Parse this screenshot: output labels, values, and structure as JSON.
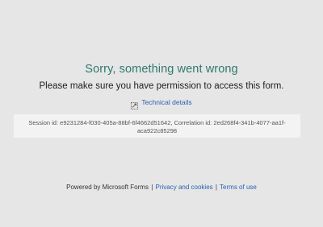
{
  "error": {
    "title": "Sorry, something went wrong",
    "message": "Please make sure you have permission to access this form.",
    "technical_details_label": "Technical details",
    "technical_details_icon": "expand-details-icon",
    "session_label": "Session id:",
    "session_id": "e9231284-f030-405a-88bf-6f4662d51642",
    "correlation_label": "Correlation id:",
    "correlation_id": "2ed268f4-341b-4077-aa1f-aca922c85298"
  },
  "footer": {
    "powered_by": "Powered by Microsoft Forms",
    "separator": "|",
    "privacy_link": "Privacy and cookies",
    "terms_link": "Terms of use"
  },
  "colors": {
    "background": "#e6e6e6",
    "title": "#2f7a6f",
    "link": "#2a61b5",
    "details_box": "#f3f3f3"
  }
}
